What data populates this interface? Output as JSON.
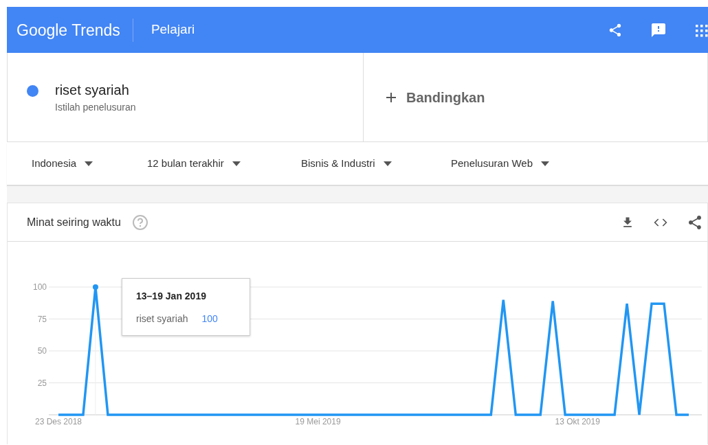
{
  "header": {
    "logo": "Google Trends",
    "section": "Pelajari"
  },
  "terms": [
    {
      "name": "riset syariah",
      "subtitle": "Istilah penelusuran",
      "color": "#4285f4"
    }
  ],
  "compare": {
    "label": "Bandingkan"
  },
  "filters": [
    {
      "label": "Indonesia"
    },
    {
      "label": "12 bulan terakhir"
    },
    {
      "label": "Bisnis & Industri"
    },
    {
      "label": "Penelusuran Web"
    }
  ],
  "interest_card": {
    "title": "Minat seiring waktu",
    "chart_data": {
      "type": "line",
      "categories": [
        "23 Des 2018",
        null,
        null,
        null,
        null,
        null,
        null,
        null,
        null,
        null,
        null,
        null,
        null,
        null,
        null,
        null,
        null,
        null,
        null,
        null,
        null,
        "19 Mei 2019",
        null,
        null,
        null,
        null,
        null,
        null,
        null,
        null,
        null,
        null,
        null,
        null,
        null,
        null,
        null,
        null,
        null,
        null,
        null,
        null,
        "13 Okt 2019",
        null,
        null,
        null,
        null,
        null,
        null,
        null,
        null,
        null
      ],
      "series": [
        {
          "name": "riset syariah",
          "color": "#2196f3",
          "values": [
            0,
            0,
            0,
            100,
            0,
            0,
            0,
            0,
            0,
            0,
            0,
            0,
            0,
            0,
            0,
            0,
            0,
            0,
            0,
            0,
            0,
            0,
            0,
            0,
            0,
            0,
            0,
            0,
            0,
            0,
            0,
            0,
            0,
            0,
            0,
            0,
            90,
            0,
            0,
            0,
            89,
            0,
            0,
            0,
            0,
            0,
            87,
            0,
            87,
            87,
            0,
            0
          ]
        }
      ],
      "ylim": [
        0,
        100
      ],
      "yticks": [
        25,
        50,
        75,
        100
      ],
      "grid": true
    },
    "tooltip": {
      "date": "13–19 Jan 2019",
      "value": "100"
    }
  }
}
